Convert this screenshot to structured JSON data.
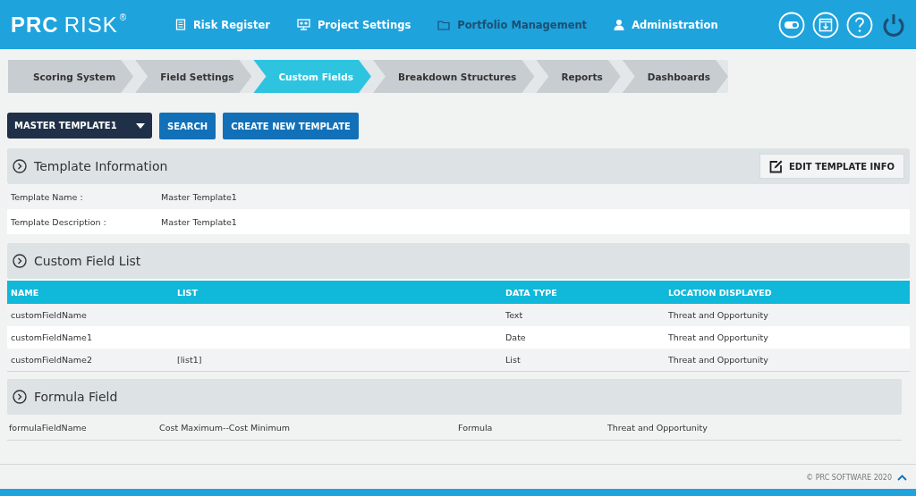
{
  "logo": {
    "brand": "PRC",
    "product": "RISK",
    "mark": "®"
  },
  "nav": [
    {
      "label": "Risk Register",
      "selected": false
    },
    {
      "label": "Project Settings",
      "selected": false
    },
    {
      "label": "Portfolio Management",
      "selected": true
    },
    {
      "label": "Administration",
      "selected": false
    }
  ],
  "steps": [
    {
      "label": "Scoring System",
      "selected": false
    },
    {
      "label": "Field Settings",
      "selected": false
    },
    {
      "label": "Custom Fields",
      "selected": true
    },
    {
      "label": "Breakdown Structures",
      "selected": false
    },
    {
      "label": "Reports",
      "selected": false
    },
    {
      "label": "Dashboards",
      "selected": false
    }
  ],
  "template_select": {
    "value": "MASTER TEMPLATE1"
  },
  "buttons": [
    "SEARCH",
    "CREATE NEW TEMPLATE"
  ],
  "template_info": {
    "title": "Template Information",
    "edit_button": "EDIT TEMPLATE INFO",
    "rows": [
      {
        "label": "Template Name :",
        "value": "Master Template1"
      },
      {
        "label": "Template Description :",
        "value": "Master Template1"
      }
    ]
  },
  "custom_field_list": {
    "title": "Custom Field List",
    "columns": [
      "NAME",
      "LIST",
      "DATA TYPE",
      "LOCATION DISPLAYED"
    ],
    "rows": [
      [
        "customFieldName",
        "",
        "Text",
        "Threat and Opportunity"
      ],
      [
        "customFieldName1",
        "",
        "Date",
        "Threat and Opportunity"
      ],
      [
        "customFieldName2",
        "[list1]",
        "List",
        "Threat and Opportunity"
      ]
    ]
  },
  "formula_field": {
    "title": "Formula Field",
    "rows": [
      [
        "formulaFieldName",
        "Cost Maximum--Cost Minimum",
        "Formula",
        "Threat and Opportunity"
      ]
    ]
  },
  "footer": {
    "copyright": "© PRC SOFTWARE 2020"
  }
}
